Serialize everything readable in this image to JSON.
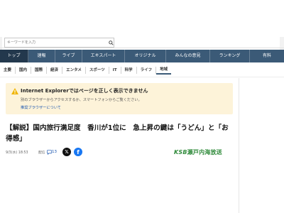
{
  "search": {
    "placeholder": "キーワードを入力"
  },
  "primary_nav": [
    {
      "label": "トップ",
      "active": true
    },
    {
      "label": "速報"
    },
    {
      "label": "ライブ"
    },
    {
      "label": "エキスパート"
    },
    {
      "label": "オリジナル"
    },
    {
      "label": "みんなの意見"
    },
    {
      "label": "ランキング"
    },
    {
      "label": "有料"
    }
  ],
  "secondary_nav": [
    {
      "label": "主要"
    },
    {
      "label": "国内"
    },
    {
      "label": "国際"
    },
    {
      "label": "経済"
    },
    {
      "label": "エンタメ"
    },
    {
      "label": "スポーツ"
    },
    {
      "label": "IT"
    },
    {
      "label": "科学"
    },
    {
      "label": "ライフ"
    },
    {
      "label": "地域",
      "active": true
    }
  ],
  "notice": {
    "title": "Internet Explorerではページを正しく表示できません",
    "body": "別のブラウザーからアクセスするか、スマートフォンからご覧ください。",
    "link": "推奨ブラウザーについて"
  },
  "article": {
    "headline": "【解説】国内旅行満足度　香川が1位に　急上昇の鍵は「うどん」と「お得感」",
    "date": "9/3(水) 18:53",
    "source": "配信",
    "comment_count": "13",
    "brand": {
      "prefix": "KSB",
      "name": "瀬戸内海放送"
    }
  },
  "colors": {
    "nav_bg": "#3b5a77",
    "notice_bg": "#fdf3d9",
    "brand": "#2f8a3a",
    "facebook": "#1877f2"
  }
}
